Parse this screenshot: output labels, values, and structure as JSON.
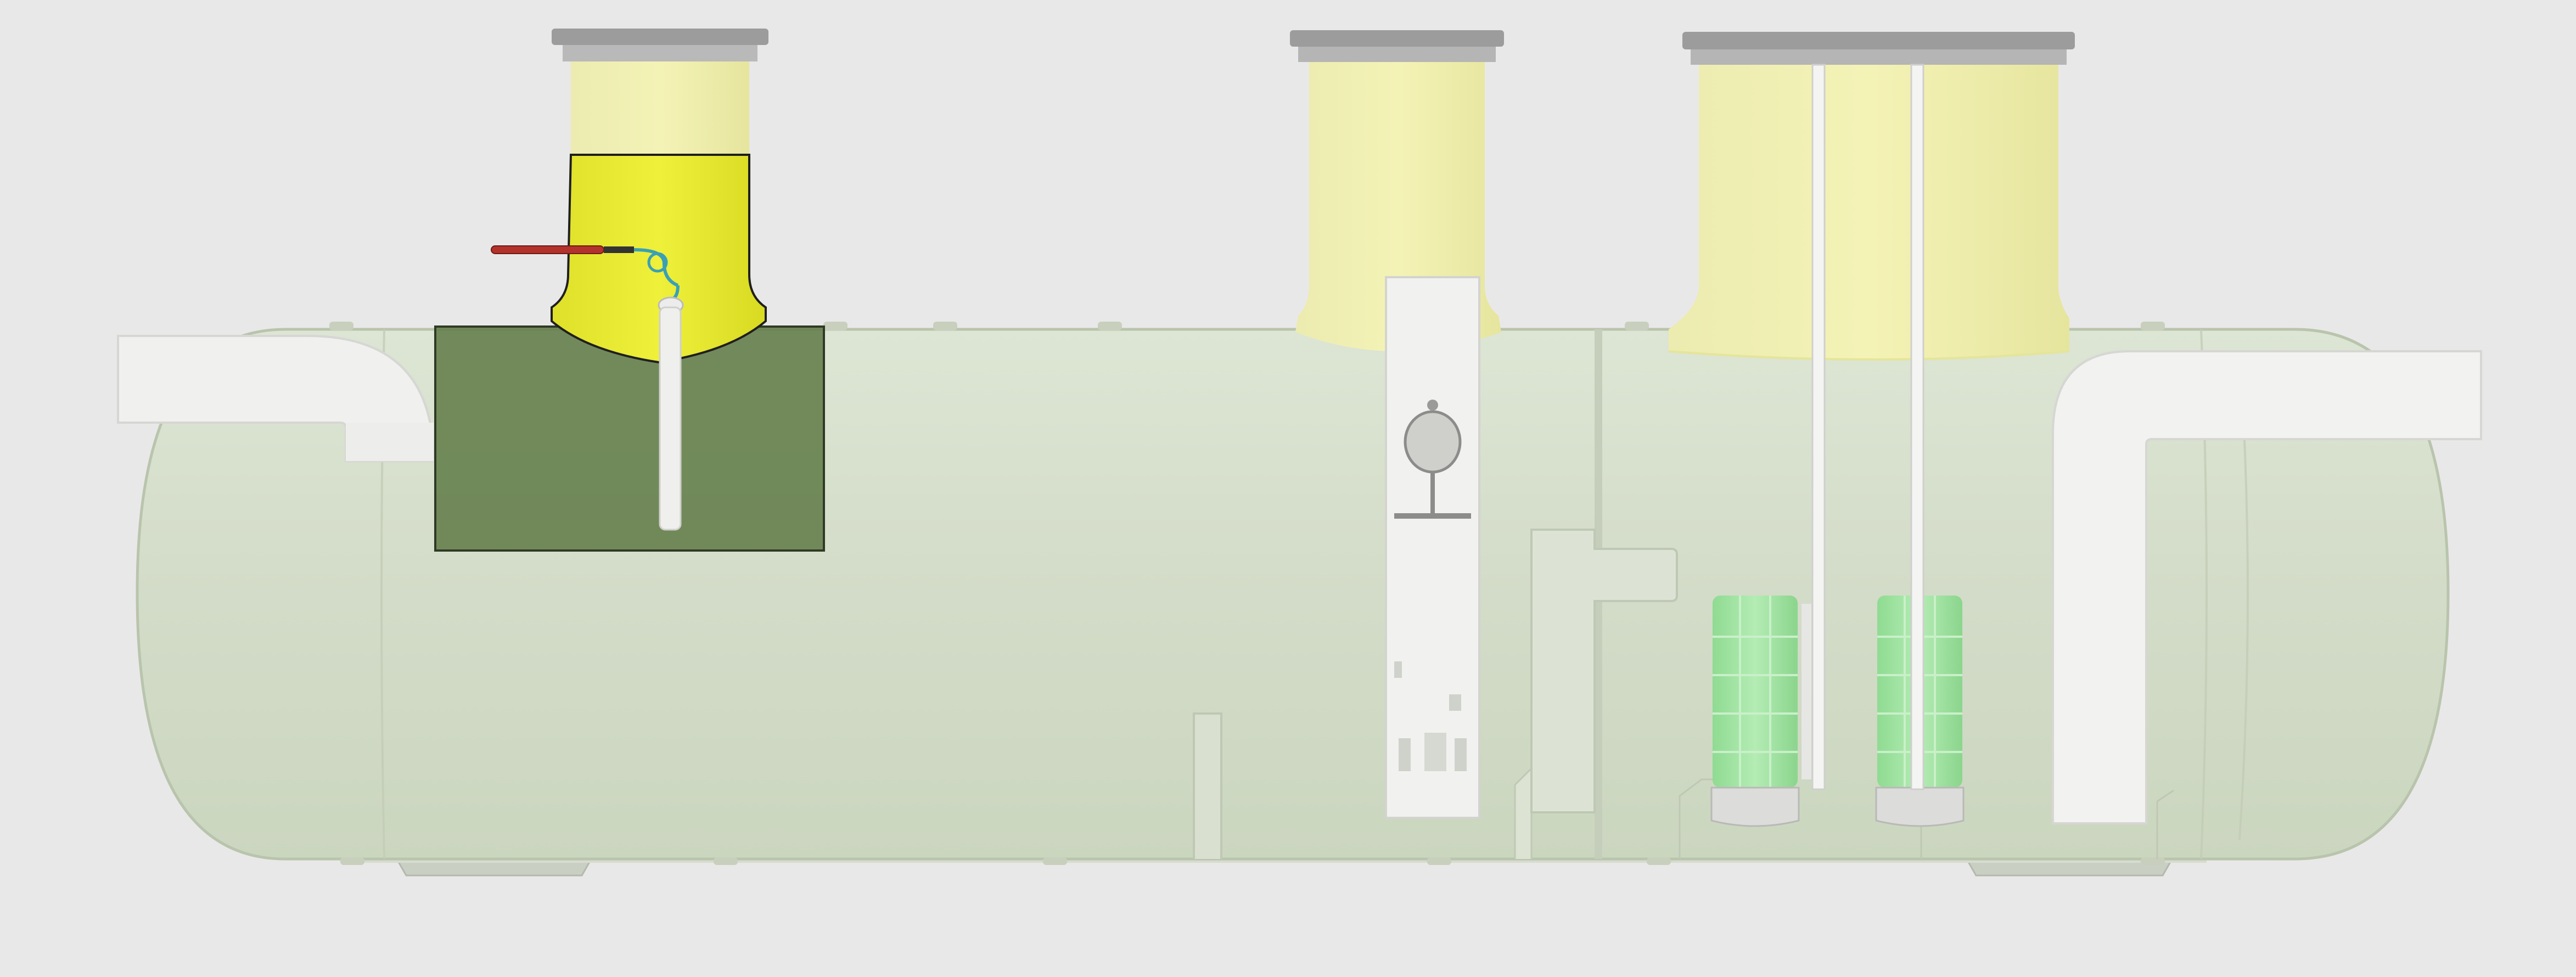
{
  "diagram": {
    "subject": "tank-cross-section",
    "labels": []
  },
  "colors": {
    "background": "#e9e8e8",
    "tank_body": "#d6dfcb",
    "tank_outline": "#b9c4ad",
    "riser_yellow": "#f1f0a8",
    "riser_highlight": "#e8ea3a",
    "highlight_box": "#5f7a45",
    "cap_grey": "#9c9c9c",
    "internal_white": "#f1f1ef",
    "filter_green": "#9fe3a1",
    "probe_red": "#b4322c",
    "cable_cyan": "#3aa0b5"
  },
  "components": [
    {
      "id": "inlet-pipe",
      "icon": "pipe-elbow-icon"
    },
    {
      "id": "riser-1",
      "icon": "manhole-riser-icon",
      "highlighted": true
    },
    {
      "id": "level-probe",
      "icon": "probe-icon"
    },
    {
      "id": "riser-2",
      "icon": "manhole-riser-icon"
    },
    {
      "id": "float-switch",
      "icon": "float-icon"
    },
    {
      "id": "riser-3",
      "icon": "manhole-riser-icon"
    },
    {
      "id": "coalescing-filter-1",
      "icon": "filter-cartridge-icon"
    },
    {
      "id": "coalescing-filter-2",
      "icon": "filter-cartridge-icon"
    },
    {
      "id": "outlet-pipe",
      "icon": "pipe-elbow-icon"
    }
  ]
}
